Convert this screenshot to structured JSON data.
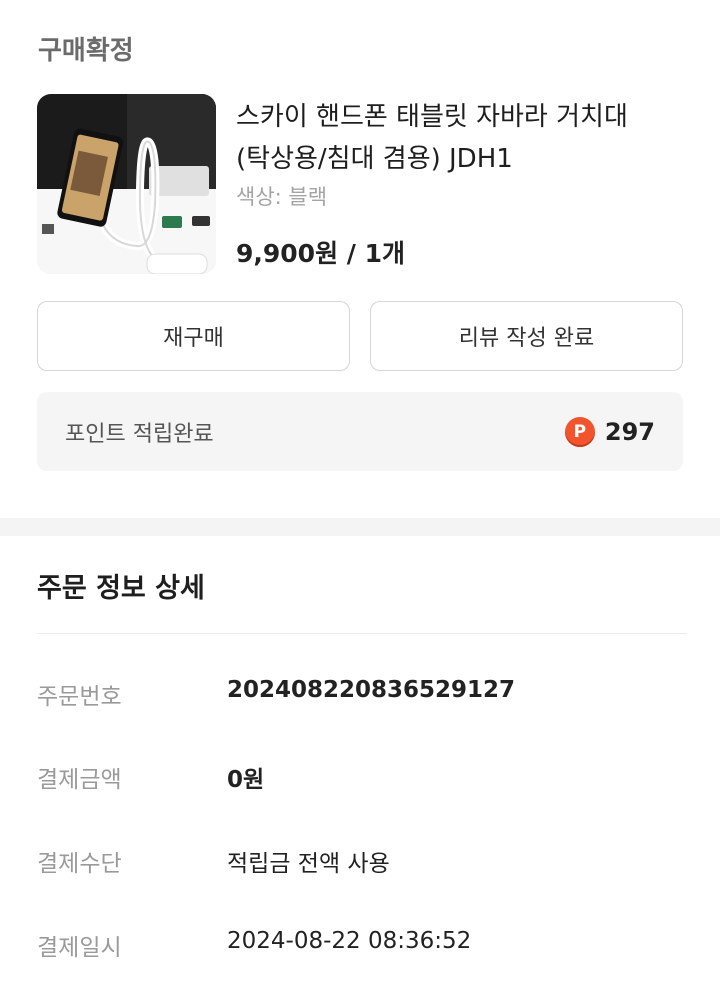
{
  "order": {
    "status_label": "구매확정",
    "product": {
      "name_line1": "스카이 핸드폰 태블릿 자바라 거치대",
      "name_line2": "(탁상용/침대 겸용) JDH1",
      "option": "색상: 블랙",
      "price_qty": "9,900원 / 1개"
    },
    "actions": {
      "rebuy_label": "재구매",
      "review_label": "리뷰 작성 완료"
    },
    "points": {
      "label": "포인트 적립완료",
      "icon": "P",
      "amount": "297"
    }
  },
  "details": {
    "title": "주문 정보 상세",
    "rows": [
      {
        "key": "주문번호",
        "value": "20240822083652912 7"
      },
      {
        "key": "결제금액",
        "value": "0원"
      },
      {
        "key": "결제수단",
        "value": "적립금 전액 사용"
      },
      {
        "key": "결제일시",
        "value": "2024-08-22 08:36:52"
      }
    ]
  }
}
